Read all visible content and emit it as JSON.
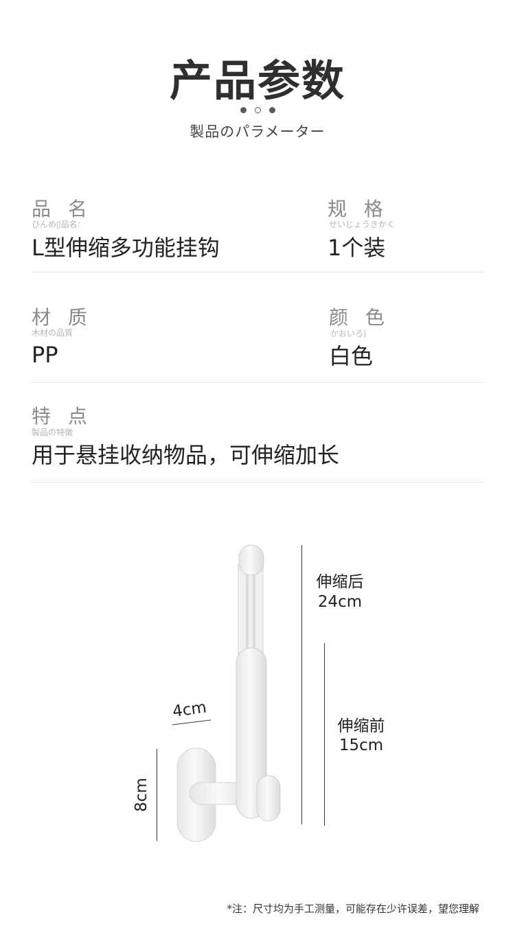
{
  "header": {
    "title": "产品参数",
    "subtitle": "製品のパラメーター"
  },
  "params": [
    {
      "label": "品 名",
      "ruby": "ひんめ▯品名:",
      "value": "L型伸缩多功能挂钩"
    },
    {
      "label": "规 格",
      "ruby": "せいじょうきかく",
      "value": "1个装"
    },
    {
      "label": "材 质",
      "ruby": "木材の品質",
      "value": "PP"
    },
    {
      "label": "颜 色",
      "ruby": "かおいろ)",
      "value": "白色"
    },
    {
      "label": "特 点",
      "ruby": "製品の特徴",
      "value": "用于悬挂收纳物品，可伸缩加长"
    }
  ],
  "dimensions": {
    "extended_label": "伸缩后",
    "extended_value": "24cm",
    "retracted_label": "伸缩前",
    "retracted_value": "15cm",
    "width": "4cm",
    "base_height": "8cm"
  },
  "note": "*注：尺寸均为手工测量，可能存在少许误差，望您理解",
  "colors": {
    "product": "#f2f2f2",
    "product_shadow": "#d9d9d9",
    "text_dark": "#222222",
    "label_grey": "#8a8a8a"
  }
}
